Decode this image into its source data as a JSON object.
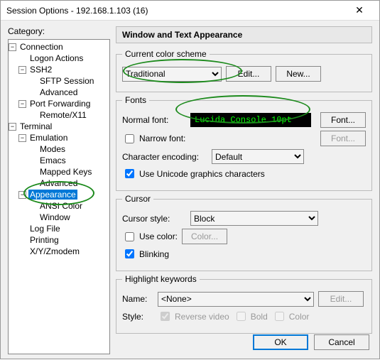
{
  "title": "Session Options - 192.168.1.103 (16)",
  "category_label": "Category:",
  "tree": {
    "n0": "Connection",
    "n1": "Logon Actions",
    "n2": "SSH2",
    "n3": "SFTP Session",
    "n4": "Advanced",
    "n5": "Port Forwarding",
    "n6": "Remote/X11",
    "n7": "Terminal",
    "n8": "Emulation",
    "n9": "Modes",
    "n10": "Emacs",
    "n11": "Mapped Keys",
    "n12": "Advanced",
    "n13": "Appearance",
    "n14": "ANSI Color",
    "n15": "Window",
    "n16": "Log File",
    "n17": "Printing",
    "n18": "X/Y/Zmodem"
  },
  "header": "Window and Text Appearance",
  "scheme": {
    "legend": "Current color scheme",
    "value": "Traditional",
    "edit": "Edit...",
    "new": "New..."
  },
  "fonts": {
    "legend": "Fonts",
    "normal_label": "Normal font:",
    "preview": "Lucida Console 10pt",
    "font_btn": "Font...",
    "narrow_label": "Narrow font:",
    "narrow_btn": "Font...",
    "enc_label": "Character encoding:",
    "enc_value": "Default",
    "uni_label": "Use Unicode graphics characters"
  },
  "cursor": {
    "legend": "Cursor",
    "style_label": "Cursor style:",
    "style_value": "Block",
    "usecolor_label": "Use color:",
    "color_btn": "Color...",
    "blink_label": "Blinking"
  },
  "hl": {
    "legend": "Highlight keywords",
    "name_label": "Name:",
    "name_value": "<None>",
    "edit": "Edit...",
    "style_label": "Style:",
    "rev": "Reverse video",
    "bold": "Bold",
    "color": "Color"
  },
  "footer": {
    "ok": "OK",
    "cancel": "Cancel"
  },
  "colors": {
    "accent": "#0078d7",
    "annot": "#1c8a1c"
  }
}
